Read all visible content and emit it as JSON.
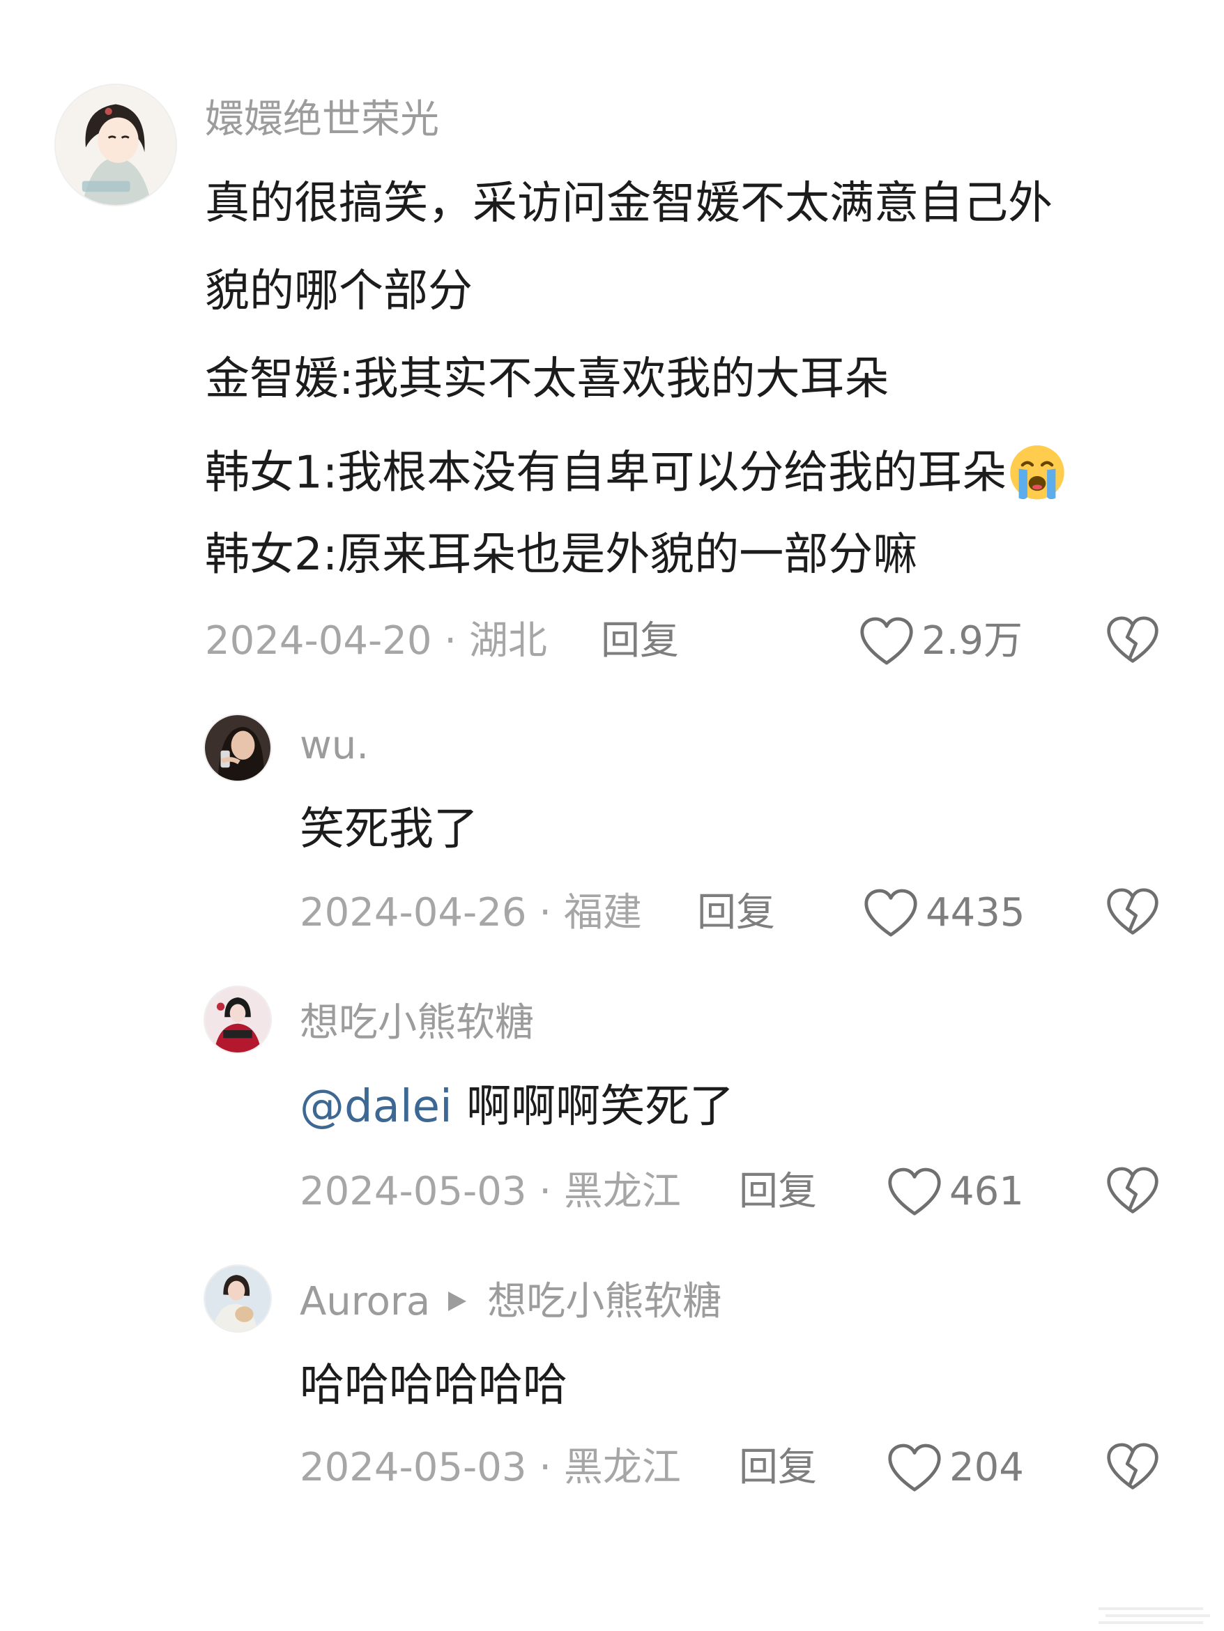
{
  "comments": [
    {
      "username": "嬛嬛绝世荣光",
      "lines": [
        "真的很搞笑，采访问金智媛不太满意自己外",
        "貌的哪个部分",
        "金智媛:我其实不太喜欢我的大耳朵",
        "韩女1:我根本没有自卑可以分给我的耳朵",
        "韩女2:原来耳朵也是外貌的一部分嘛"
      ],
      "date_location": "2024-04-20 · 湖北",
      "reply_label": "回复",
      "likes": "2.9万"
    },
    {
      "username": "wu.",
      "text": "笑死我了",
      "date_location": "2024-04-26 · 福建",
      "reply_label": "回复",
      "likes": "4435"
    },
    {
      "username": "想吃小熊软糖",
      "mention": "@dalei",
      "text": " 啊啊啊笑死了",
      "date_location": "2024-05-03 · 黑龙江",
      "reply_label": "回复",
      "likes": "461"
    },
    {
      "username": "Aurora",
      "reply_to": "想吃小熊软糖",
      "text": "哈哈哈哈哈哈",
      "date_location": "2024-05-03 · 黑龙江",
      "reply_label": "回复",
      "likes": "204"
    }
  ],
  "icons": {
    "like": "heart-outline-icon",
    "dislike": "broken-heart-icon",
    "emoji": "loudly-crying-face"
  },
  "colors": {
    "text": "#1c1c1c",
    "meta": "#a6a6a6",
    "mention": "#3e6894"
  }
}
